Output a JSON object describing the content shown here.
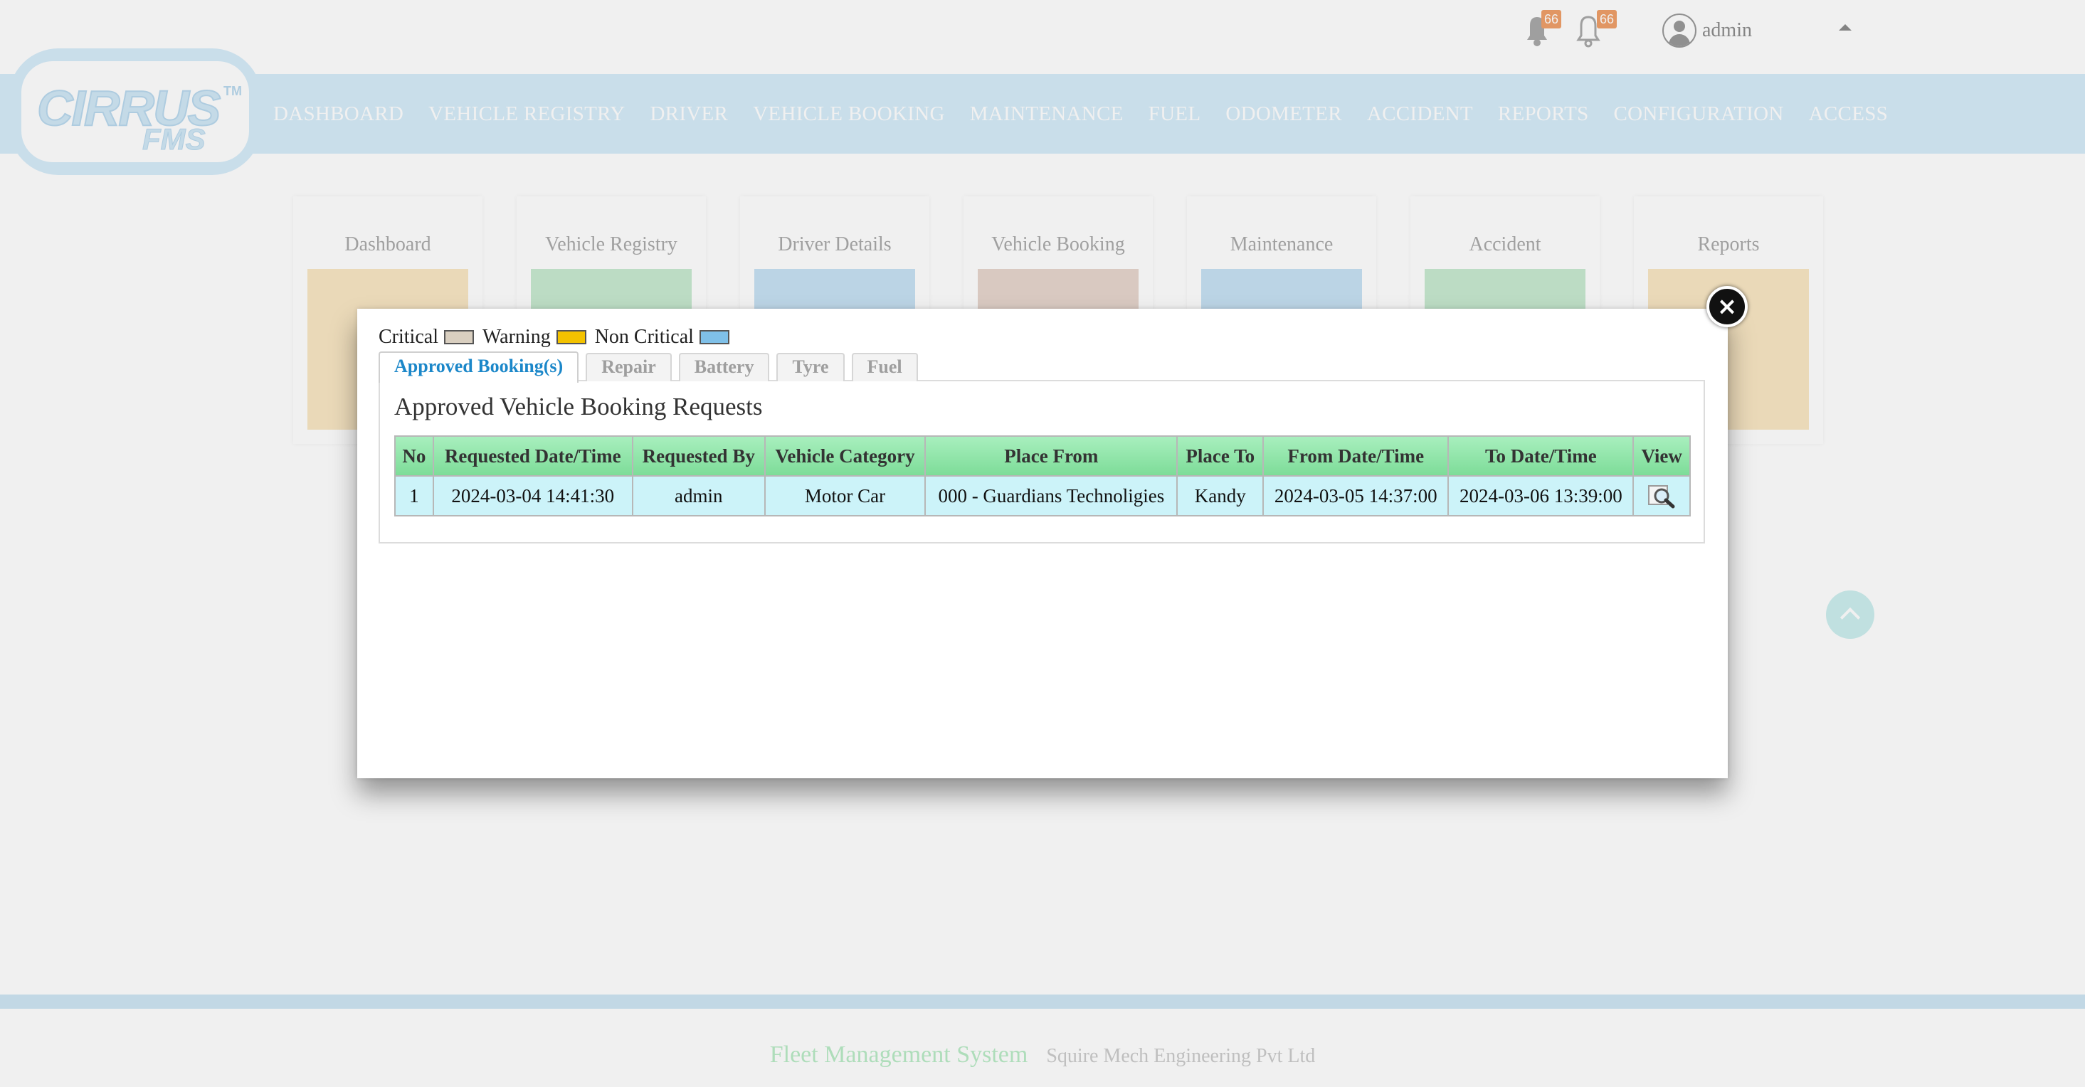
{
  "header": {
    "notifications": [
      {
        "icon": "bell-filled-icon",
        "count": "66"
      },
      {
        "icon": "bell-outline-icon",
        "count": "66"
      }
    ],
    "user": {
      "name": "admin"
    }
  },
  "logo": {
    "brand": "CIRRUS",
    "tm": "TM",
    "sub": "FMS"
  },
  "nav": {
    "items": [
      "DASHBOARD",
      "VEHICLE REGISTRY",
      "DRIVER",
      "VEHICLE BOOKING",
      "MAINTENANCE",
      "FUEL",
      "ODOMETER",
      "ACCIDENT",
      "REPORTS",
      "CONFIGURATION",
      "ACCESS"
    ]
  },
  "tiles": [
    {
      "label": "Dashboard",
      "color": "#f9e7c4"
    },
    {
      "label": "Vehicle Registry",
      "color": "#c8ead1"
    },
    {
      "label": "Driver Details",
      "color": "#c7e2f4"
    },
    {
      "label": "Vehicle Booking",
      "color": "#e7d6ce"
    },
    {
      "label": "Maintenance",
      "color": "#c7e2f4"
    },
    {
      "label": "Accident",
      "color": "#c8ead1"
    },
    {
      "label": "Reports",
      "color": "#f9e7c4"
    }
  ],
  "modal": {
    "legend": [
      {
        "label": "Critical",
        "color": "#d9cfc0"
      },
      {
        "label": "Warning",
        "color": "#f3c200"
      },
      {
        "label": "Non Critical",
        "color": "#7fc0e8"
      }
    ],
    "tabs": [
      "Approved Booking(s)",
      "Repair",
      "Battery",
      "Tyre",
      "Fuel"
    ],
    "active_tab": "Approved Booking(s)",
    "panel_title": "Approved Vehicle Booking Requests",
    "table": {
      "columns": [
        "No",
        "Requested Date/Time",
        "Requested By",
        "Vehicle Category",
        "Place From",
        "Place To",
        "From Date/Time",
        "To Date/Time",
        "View"
      ],
      "rows": [
        [
          "1",
          "2024-03-04 14:41:30",
          "admin",
          "Motor Car",
          "000 - Guardians Technoligies",
          "Kandy",
          "2024-03-05 14:37:00",
          "2024-03-06 13:39:00",
          ""
        ]
      ]
    }
  },
  "footer": {
    "system": "Fleet Management System",
    "company": "Squire Mech Engineering Pvt Ltd"
  }
}
